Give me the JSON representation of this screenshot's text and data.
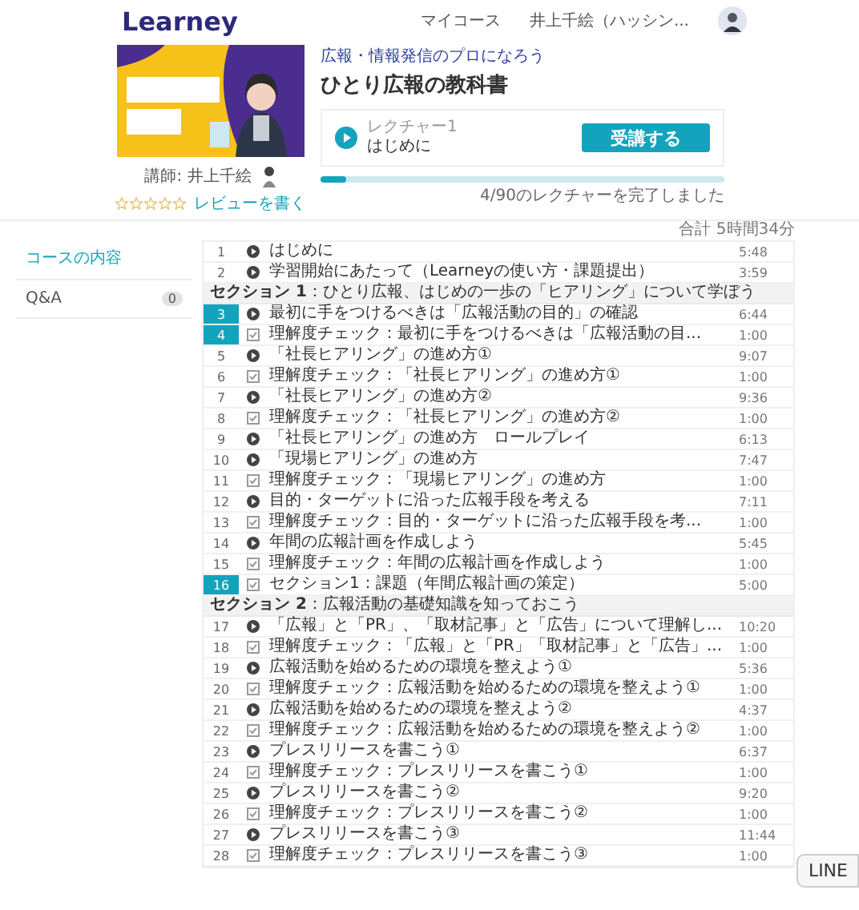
{
  "header": {
    "logo": "Learney",
    "nav": [
      {
        "label": "マイコース"
      },
      {
        "label": "井上千絵（ハッシン..."
      }
    ]
  },
  "course": {
    "category": "広報・情報発信のプロになろう",
    "title": "ひとり広報の教科書",
    "instructor": "講師: 井上千絵",
    "stars": 0,
    "review_link": "レビューを書く",
    "lecture_label": "レクチャー1",
    "lecture_title": "はじめに",
    "start_button": "受講する",
    "progress": {
      "level": 0.065,
      "text": "4/90のレクチャーを完了しました"
    }
  },
  "side_tabs": [
    {
      "label": "コースの内容",
      "selected": true
    },
    {
      "label": "Q&A",
      "selected": false,
      "count": "0"
    }
  ],
  "total": "合計 5時間34分",
  "curriculum": [
    {
      "kind": "video",
      "number": "1",
      "title": "はじめに",
      "duration": "5:48",
      "selected": false
    },
    {
      "kind": "video",
      "number": "2",
      "title": "学習開始にあたって（Learneyの使い方・課題提出）",
      "duration": "3:59",
      "selected": false
    },
    {
      "kind": "section",
      "title": "**セクション 1**：ひとり広報、はじめの一歩の「ヒアリング」について学ぼう"
    },
    {
      "kind": "video",
      "number": "3",
      "title": "最初に手をつけるべきは「広報活動の目的」の確認",
      "duration": "6:44",
      "selected": true
    },
    {
      "kind": "quiz",
      "number": "4",
      "title": "理解度チェック：最初に手をつけるべきは「広報活動の目...",
      "duration": "1:00",
      "selected": true
    },
    {
      "kind": "video",
      "number": "5",
      "title": "「社長ヒアリング」の進め方①",
      "duration": "9:07",
      "selected": false
    },
    {
      "kind": "quiz",
      "number": "6",
      "title": "理解度チェック：「社長ヒアリング」の進め方①",
      "duration": "1:00",
      "selected": false
    },
    {
      "kind": "video",
      "number": "7",
      "title": "「社長ヒアリング」の進め方②",
      "duration": "9:36",
      "selected": false
    },
    {
      "kind": "quiz",
      "number": "8",
      "title": "理解度チェック：「社長ヒアリング」の進め方②",
      "duration": "1:00",
      "selected": false
    },
    {
      "kind": "video",
      "number": "9",
      "title": "「社長ヒアリング」の進め方　ロールプレイ",
      "duration": "6:13",
      "selected": false
    },
    {
      "kind": "video",
      "number": "10",
      "title": "「現場ヒアリング」の進め方",
      "duration": "7:47",
      "selected": false
    },
    {
      "kind": "quiz",
      "number": "11",
      "title": "理解度チェック：「現場ヒアリング」の進め方",
      "duration": "1:00",
      "selected": false
    },
    {
      "kind": "video",
      "number": "12",
      "title": "目的・ターゲットに沿った広報手段を考える",
      "duration": "7:11",
      "selected": false
    },
    {
      "kind": "quiz",
      "number": "13",
      "title": "理解度チェック：目的・ターゲットに沿った広報手段を考...",
      "duration": "1:00",
      "selected": false
    },
    {
      "kind": "video",
      "number": "14",
      "title": "年間の広報計画を作成しよう",
      "duration": "5:45",
      "selected": false
    },
    {
      "kind": "quiz",
      "number": "15",
      "title": "理解度チェック：年間の広報計画を作成しよう",
      "duration": "1:00",
      "selected": false
    },
    {
      "kind": "quiz",
      "number": "16",
      "title": "セクション1：課題（年間広報計画の策定）",
      "duration": "5:00",
      "selected": true
    },
    {
      "kind": "section",
      "title": "**セクション 2**：広報活動の基礎知識を知っておこう"
    },
    {
      "kind": "video",
      "number": "17",
      "title": "「広報」と「PR」、「取材記事」と「広告」について理解し...",
      "duration": "10:20",
      "selected": false
    },
    {
      "kind": "quiz",
      "number": "18",
      "title": "理解度チェック：「広報」と「PR」「取材記事」と「広告」...",
      "duration": "1:00",
      "selected": false
    },
    {
      "kind": "video",
      "number": "19",
      "title": "広報活動を始めるための環境を整えよう①",
      "duration": "5:36",
      "selected": false
    },
    {
      "kind": "quiz",
      "number": "20",
      "title": "理解度チェック：広報活動を始めるための環境を整えよう①",
      "duration": "1:00",
      "selected": false
    },
    {
      "kind": "video",
      "number": "21",
      "title": "広報活動を始めるための環境を整えよう②",
      "duration": "4:37",
      "selected": false
    },
    {
      "kind": "quiz",
      "number": "22",
      "title": "理解度チェック：広報活動を始めるための環境を整えよう②",
      "duration": "1:00",
      "selected": false
    },
    {
      "kind": "video",
      "number": "23",
      "title": "プレスリリースを書こう①",
      "duration": "6:37",
      "selected": false
    },
    {
      "kind": "quiz",
      "number": "24",
      "title": "理解度チェック：プレスリリースを書こう①",
      "duration": "1:00",
      "selected": false
    },
    {
      "kind": "video",
      "number": "25",
      "title": "プレスリリースを書こう②",
      "duration": "9:20",
      "selected": false
    },
    {
      "kind": "quiz",
      "number": "26",
      "title": "理解度チェック：プレスリリースを書こう②",
      "duration": "1:00",
      "selected": false
    },
    {
      "kind": "video",
      "number": "27",
      "title": "プレスリリースを書こう③",
      "duration": "11:44",
      "selected": false
    },
    {
      "kind": "quiz",
      "number": "28",
      "title": "理解度チェック：プレスリリースを書こう③",
      "duration": "1:00",
      "selected": false
    }
  ],
  "chat_button": "LINE"
}
